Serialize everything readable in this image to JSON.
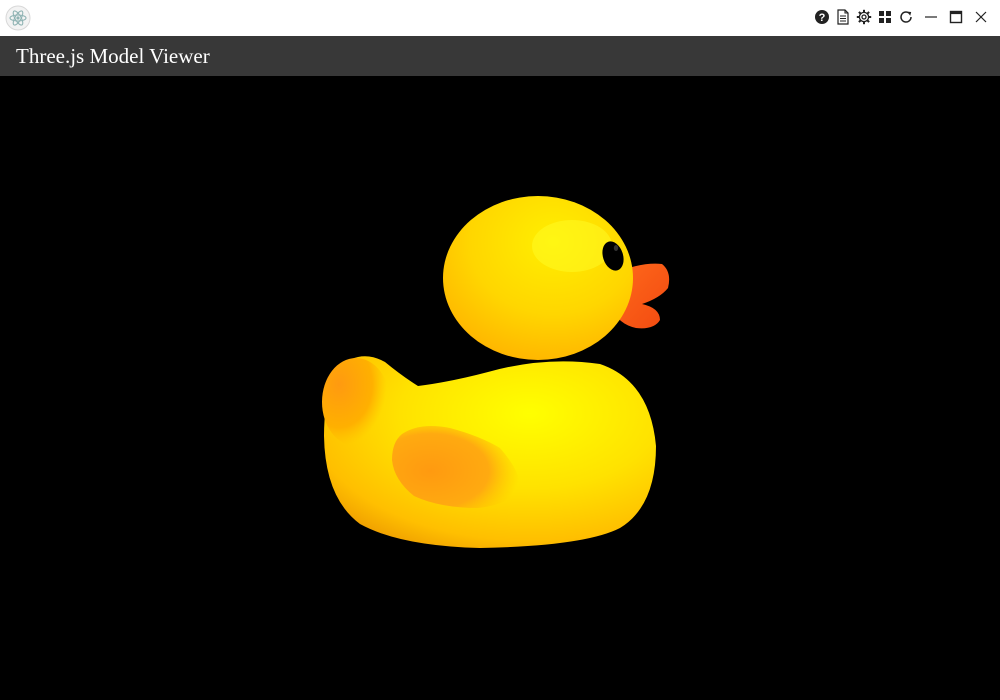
{
  "window": {
    "app_icon": "atom-app-icon",
    "controls": [
      "help-icon",
      "document-icon",
      "settings-icon",
      "grid-icon",
      "reload-icon",
      "minimize-icon",
      "maximize-icon",
      "close-icon"
    ]
  },
  "header": {
    "title": "Three.js Model Viewer"
  },
  "viewport": {
    "background": "#000000",
    "model": "rubber-duck",
    "colors": {
      "body": "#FFD200",
      "highlight": "#FFFF00",
      "wing": "#FF9A10",
      "beak": "#FF5A18",
      "eye": "#000000"
    }
  }
}
